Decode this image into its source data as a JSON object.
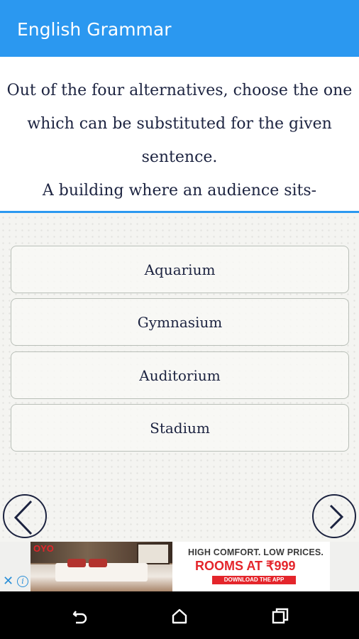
{
  "app_bar": {
    "title": "English Grammar"
  },
  "question": {
    "lines": [
      "Out of the four alternatives, choose the one",
      "which can be substituted for  the  given",
      "sentence.",
      "A building where an audience sits-"
    ]
  },
  "options": [
    "Aquarium",
    "Gymnasium",
    "Auditorium",
    "Stadium"
  ],
  "navigation": {
    "prev_icon": "chevron-left-icon",
    "next_icon": "chevron-right-icon"
  },
  "ad": {
    "brand": "OYO",
    "headline": "HIGH COMFORT. LOW PRICES.",
    "offer": "ROOMS AT ₹999",
    "cta": "DOWNLOAD THE APP",
    "close_icon": "close-icon",
    "info_icon": "info-icon"
  },
  "system_nav": {
    "back_icon": "back-icon",
    "home_icon": "home-icon",
    "recents_icon": "recents-icon"
  },
  "colors": {
    "primary": "#2b98f0",
    "text": "#1c2340",
    "background": "#f4f4f1",
    "ad_red": "#e4252b"
  }
}
